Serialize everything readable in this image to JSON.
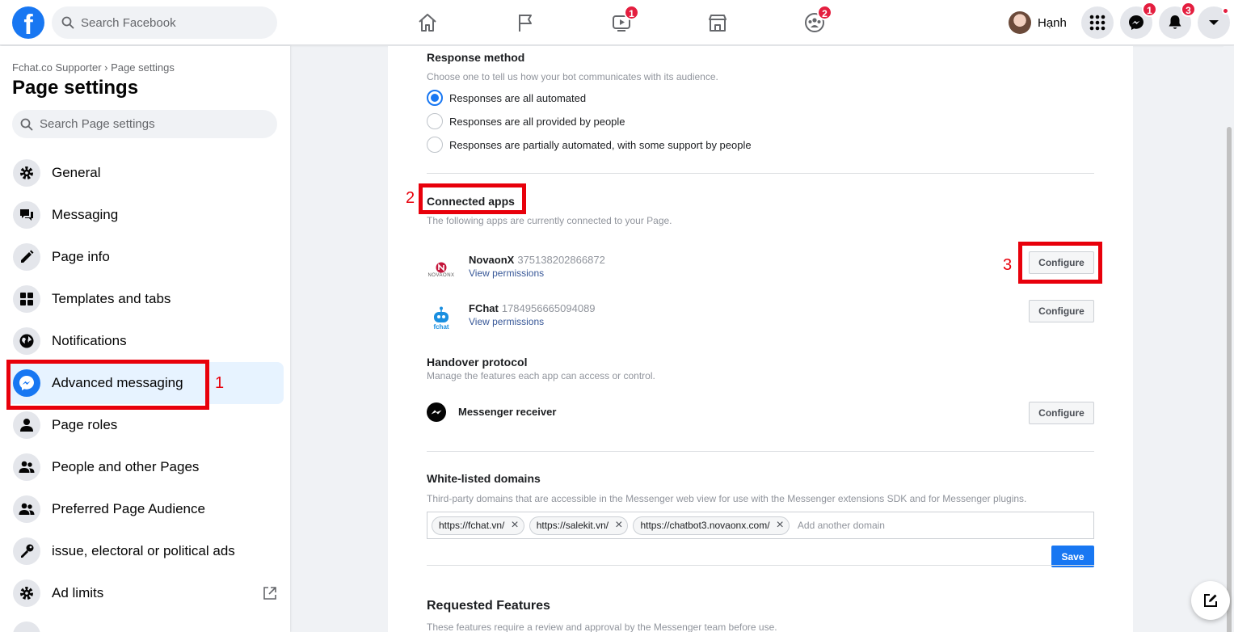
{
  "topbar": {
    "logo_text": "f",
    "search_placeholder": "Search Facebook",
    "nav_badges": {
      "watch": "1",
      "groups": "2"
    },
    "profile_name": "Hạnh",
    "messenger_badge": "1",
    "notifications_badge": "3"
  },
  "sidebar": {
    "breadcrumb": "Fchat.co Supporter › Page settings",
    "title": "Page settings",
    "search_placeholder": "Search Page settings",
    "items": [
      {
        "label": "General",
        "icon": "gear-icon"
      },
      {
        "label": "Messaging",
        "icon": "chat-bubbles-icon"
      },
      {
        "label": "Page info",
        "icon": "pencil-icon"
      },
      {
        "label": "Templates and tabs",
        "icon": "grid-icon"
      },
      {
        "label": "Notifications",
        "icon": "globe-icon"
      },
      {
        "label": "Advanced messaging",
        "icon": "messenger-icon",
        "active": true
      },
      {
        "label": "Page roles",
        "icon": "person-icon"
      },
      {
        "label": "People and other Pages",
        "icon": "people-icon"
      },
      {
        "label": "Preferred Page Audience",
        "icon": "people-icon"
      },
      {
        "label": "issue, electoral or political ads",
        "icon": "key-icon"
      },
      {
        "label": "Ad limits",
        "icon": "gear-icon"
      }
    ]
  },
  "main": {
    "response_method": {
      "title": "Response method",
      "description": "Choose one to tell us how your bot communicates with its audience.",
      "options": [
        {
          "label": "Responses are all automated",
          "checked": true
        },
        {
          "label": "Responses are all provided by people",
          "checked": false
        },
        {
          "label": "Responses are partially automated, with some support by people",
          "checked": false
        }
      ]
    },
    "connected_apps": {
      "title": "Connected apps",
      "description": "The following apps are currently connected to your Page.",
      "apps": [
        {
          "name": "NovaonX",
          "id": "375138202866872",
          "link": "View permissions",
          "button": "Configure",
          "logo_text": "NOVAONX"
        },
        {
          "name": "FChat",
          "id": "1784956665094089",
          "link": "View permissions",
          "button": "Configure",
          "logo_text": "fchat"
        }
      ]
    },
    "handover": {
      "title": "Handover protocol",
      "description": "Manage the features each app can access or control.",
      "receiver_label": "Messenger receiver",
      "button": "Configure"
    },
    "whitelist": {
      "title": "White-listed domains",
      "description": "Third-party domains that are accessible in the Messenger web view for use with the Messenger extensions SDK and for Messenger plugins.",
      "domains": [
        "https://fchat.vn/",
        "https://salekit.vn/",
        "https://chatbot3.novaonx.com/"
      ],
      "input_placeholder": "Add another domain",
      "save_label": "Save"
    },
    "requested_features": {
      "title": "Requested Features",
      "description": "These features require a review and approval by the Messenger team before use."
    }
  },
  "annotations": {
    "one": "1",
    "two": "2",
    "three": "3"
  },
  "colors": {
    "brand": "#1877f2",
    "annotation": "#e8000b"
  }
}
